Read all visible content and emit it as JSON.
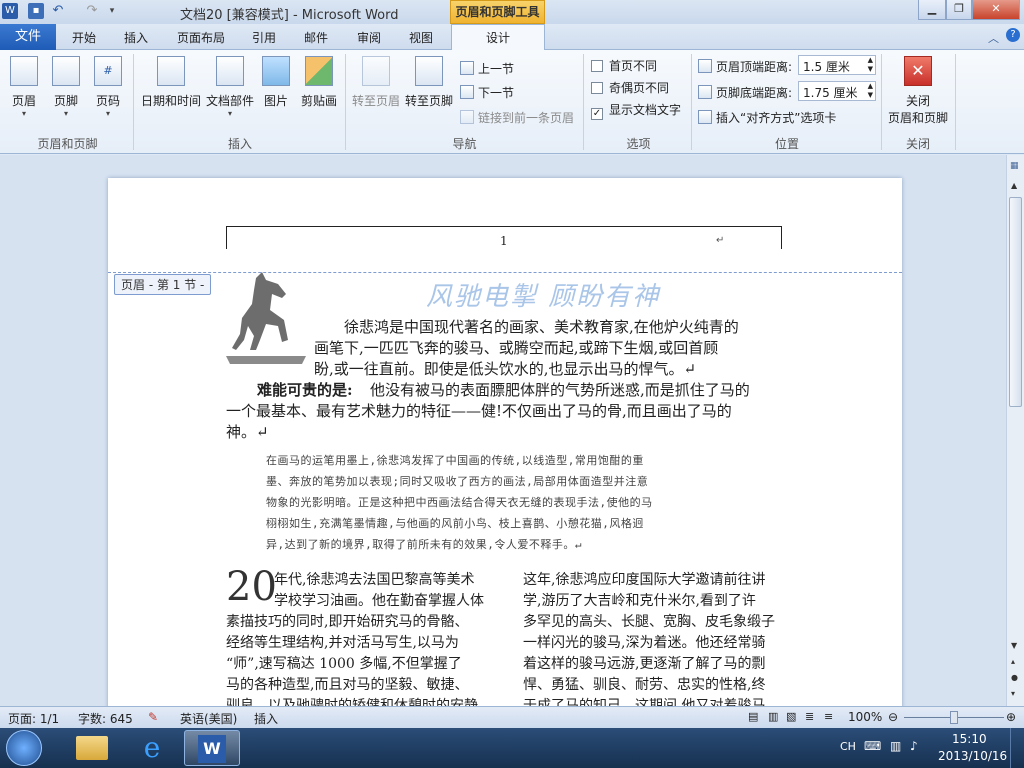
{
  "window": {
    "title": "文档20 [兼容模式] - Microsoft Word",
    "contextual_tools": "页眉和页脚工具"
  },
  "tabs": [
    "文件",
    "开始",
    "插入",
    "页面布局",
    "引用",
    "邮件",
    "审阅",
    "视图",
    "设计"
  ],
  "ribbon": {
    "header_footer": {
      "header": "页眉",
      "footer": "页脚",
      "page_number": "页码",
      "group": "页眉和页脚"
    },
    "insert": {
      "date_time": "日期和时间",
      "doc_parts": "文档部件",
      "picture": "图片",
      "clipart": "剪贴画",
      "group": "插入"
    },
    "navigation": {
      "goto_header": "转至页眉",
      "goto_footer": "转至页脚",
      "prev": "上一节",
      "next": "下一节",
      "link_prev": "链接到前一条页眉",
      "group": "导航"
    },
    "options": {
      "first_page": "首页不同",
      "odd_even": "奇偶页不同",
      "show_text": "显示文档文字",
      "group": "选项"
    },
    "position": {
      "header_top": "页眉顶端距离:",
      "header_top_value": "1.5 厘米",
      "footer_bottom": "页脚底端距离:",
      "footer_bottom_value": "1.75 厘米",
      "insert_align": "插入“对齐方式”选项卡",
      "group": "位置"
    },
    "close": {
      "label1": "关闭",
      "label2": "页眉和页脚",
      "group": "关闭"
    }
  },
  "document": {
    "page_number": "1",
    "header_tag": "页眉 - 第 1 节 -",
    "wordart": "风驰电掣  顾盼有神",
    "para1": "徐悲鸿是中国现代著名的画家、美术教育家,在他炉火纯青的画笔下,一匹匹飞奔的骏马、或腾空而起,或奔下生烟,或回首顾盼,或一往直前。即使是低头饮水的,也显示出马的悍气。",
    "para1_lines": [
      "徐悲鸿是中国现代著名的画家、美术教育家,在他炉火纯青的",
      "画笔下,一匹匹飞奔的骏马、或腾空而起,或蹄下生烟,或回首顾",
      "盼,或一往直前。即使是低头饮水的,也显示出马的悍气。↵"
    ],
    "para2_bold": "难能可贵的是:",
    "para2_lines": [
      "他没有被马的表面膘肥体胖的气势所迷惑,而是抓住了马的",
      "一个最基本、最有艺术魅力的特征——健!不仅画出了马的骨,而且画出了马的",
      "神。↵"
    ],
    "para3_lines": [
      "在画马的运笔用墨上,徐悲鸿发挥了中国画的传统,以线造型,常用饱酣的重",
      "墨、奔放的笔势加以表现;同时又吸收了西方的画法,局部用体面造型并注意",
      "物象的光影明暗。正是这种把中西画法结合得天衣无缝的表现手法,使他的马",
      "栩栩如生,充满笔墨情趣,与他画的风前小鸟、枝上喜鹊、小憩花猫,风格迥",
      "异,达到了新的境界,取得了前所未有的效果,令人爱不释手。↵"
    ],
    "dropcap": "20",
    "col1_lines": [
      "年代,徐悲鸿去法国巴黎高等美术",
      "学校学习油画。他在勤奋掌握人体",
      "素描技巧的同时,即开始研究马的骨骼、",
      "经络等生理结构,并对活马写生,以马为",
      "“师”,速写稿达 1000 多幅,不但掌握了",
      "马的各种造型,而且对马的坚毅、敏捷、",
      "驯良、以及驰骋时的矫健和休憩时的安静"
    ],
    "col2_lines": [
      "这年,徐悲鸿应印度国际大学邀请前往讲",
      "学,游历了大吉岭和克什米尔,看到了许",
      "多罕见的高头、长腿、宽胸、皮毛象缎子",
      "一样闪光的骏马,深为着迷。他还经常骑",
      "着这样的骏马远游,更逐渐了解了马的剽",
      "悍、勇猛、驯良、耐劳、忠实的性格,终",
      "于成了马的知己。这期间,他又对着骏马"
    ]
  },
  "status": {
    "page": "页面: 1/1",
    "words": "字数: 645",
    "lang": "英语(美国)",
    "mode": "插入",
    "zoom": "100%"
  },
  "clock": {
    "time": "15:10",
    "date": "2013/10/16",
    "ime": "CH"
  }
}
